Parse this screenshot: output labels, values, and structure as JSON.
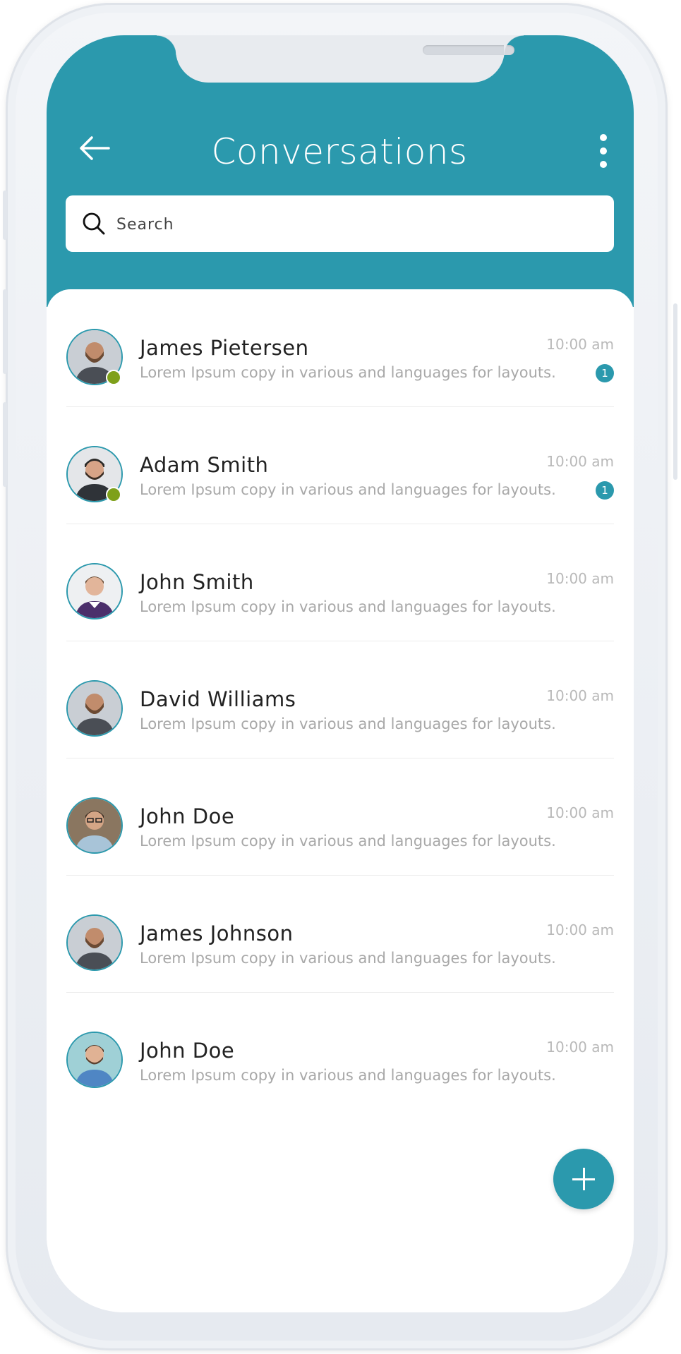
{
  "header": {
    "title": "Conversations",
    "back_icon": "arrow-left-icon",
    "menu_icon": "more-vertical-icon"
  },
  "search": {
    "placeholder": "Search",
    "icon": "search-icon"
  },
  "conversations": [
    {
      "name": "James Pietersen",
      "time": "10:00 am",
      "preview": "Lorem Ipsum copy in various and languages for layouts.",
      "unread": "1",
      "online": true
    },
    {
      "name": "Adam Smith",
      "time": "10:00 am",
      "preview": "Lorem Ipsum copy in various and languages for layouts.",
      "unread": "1",
      "online": true
    },
    {
      "name": "John Smith",
      "time": "10:00 am",
      "preview": "Lorem Ipsum copy in various and languages for layouts."
    },
    {
      "name": "David Williams",
      "time": "10:00 am",
      "preview": "Lorem Ipsum copy in various and languages for layouts."
    },
    {
      "name": "John Doe",
      "time": "10:00 am",
      "preview": "Lorem Ipsum copy in various and languages for layouts."
    },
    {
      "name": "James Johnson",
      "time": "10:00 am",
      "preview": "Lorem Ipsum copy in various and languages for layouts."
    },
    {
      "name": "John Doe",
      "time": "10:00 am",
      "preview": "Lorem Ipsum copy in various and languages for layouts."
    }
  ],
  "fab": {
    "icon": "plus-icon"
  },
  "colors": {
    "accent": "#2b99ad",
    "online": "#7ea01a"
  }
}
